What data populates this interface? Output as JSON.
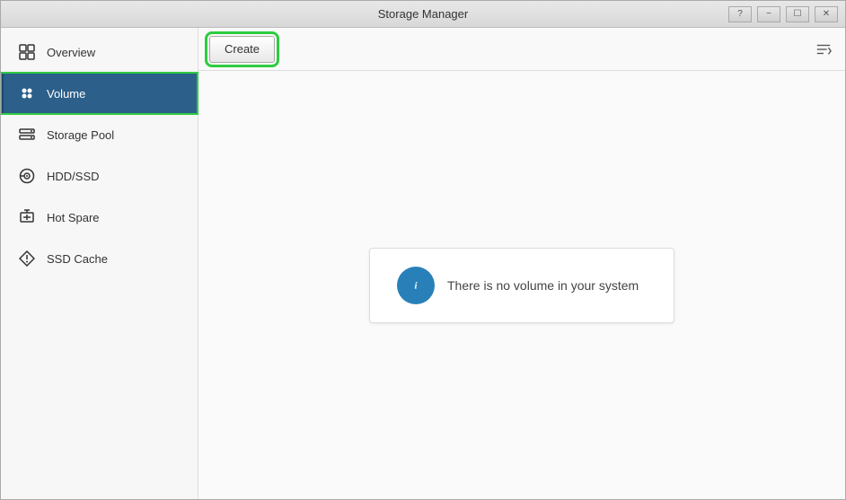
{
  "window": {
    "title": "Storage Manager"
  },
  "titlebar": {
    "controls": [
      "minimize",
      "restore",
      "close"
    ]
  },
  "sidebar": {
    "items": [
      {
        "id": "overview",
        "label": "Overview",
        "icon": "overview-icon",
        "active": false
      },
      {
        "id": "volume",
        "label": "Volume",
        "icon": "volume-icon",
        "active": true
      },
      {
        "id": "storage-pool",
        "label": "Storage Pool",
        "icon": "storage-pool-icon",
        "active": false
      },
      {
        "id": "hdd-ssd",
        "label": "HDD/SSD",
        "icon": "hdd-ssd-icon",
        "active": false
      },
      {
        "id": "hot-spare",
        "label": "Hot Spare",
        "icon": "hot-spare-icon",
        "active": false
      },
      {
        "id": "ssd-cache",
        "label": "SSD Cache",
        "icon": "ssd-cache-icon",
        "active": false
      }
    ]
  },
  "toolbar": {
    "create_label": "Create"
  },
  "main": {
    "info_message": "There is no volume in your system"
  }
}
